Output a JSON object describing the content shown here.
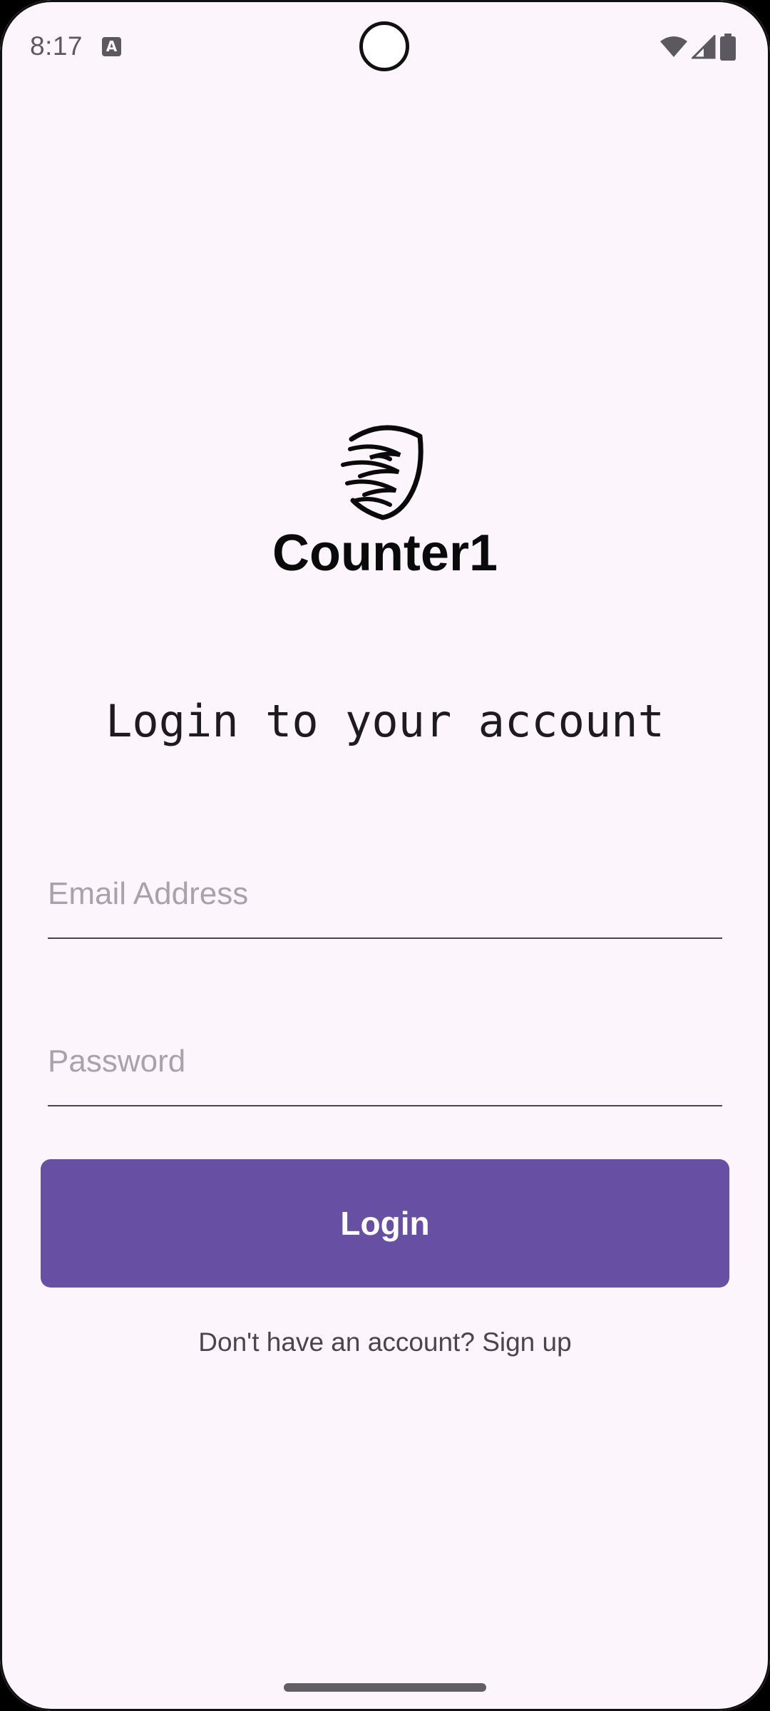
{
  "status_bar": {
    "time": "8:17",
    "notification_icon": "a-text-icon",
    "notification_glyph": "A",
    "icons": [
      "wifi-icon",
      "cellular-signal-icon",
      "battery-icon"
    ]
  },
  "brand": {
    "logo_icon": "shield-wing-icon",
    "name": "Counter1"
  },
  "login": {
    "heading": "Login to your account",
    "email_placeholder": "Email Address",
    "email_value": "",
    "password_placeholder": "Password",
    "password_value": "",
    "button_label": "Login",
    "signup_text": "Don't have an account? Sign up"
  },
  "colors": {
    "background": "#FCF5FC",
    "primary": "#6750A4",
    "on_primary": "#FFFFFF",
    "text": "#1D1B20",
    "placeholder": "#A7A2AB",
    "underline": "#49454F"
  }
}
